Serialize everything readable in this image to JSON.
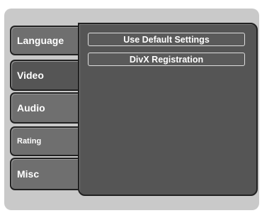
{
  "menu": {
    "tabs": [
      {
        "label": "Language"
      },
      {
        "label": "Video"
      },
      {
        "label": "Audio"
      },
      {
        "label": "Rating"
      },
      {
        "label": "Misc"
      }
    ]
  },
  "panel": {
    "options": [
      {
        "label": "Use Default Settings"
      },
      {
        "label": "DivX Registration"
      }
    ]
  },
  "colors": {
    "frame": "#c9c9c9",
    "tab": "#6f6f6f",
    "panel": "#555555",
    "outline": "#222222",
    "text": "#ffffff"
  }
}
